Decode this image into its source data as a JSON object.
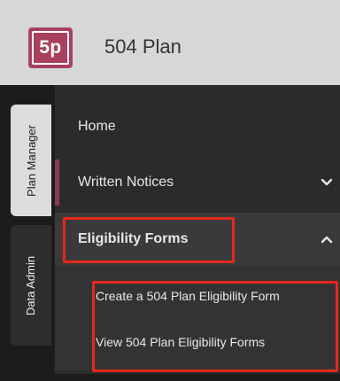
{
  "header": {
    "logo_text": "5p",
    "app_title": "504 Plan",
    "brand_color": "#a8405f"
  },
  "rail": {
    "tabs": [
      {
        "label": "Plan Manager",
        "active": true
      },
      {
        "label": "Data Admin",
        "active": false
      }
    ]
  },
  "menu": {
    "items": [
      {
        "label": "Home"
      },
      {
        "label": "Written Notices",
        "icon": "chevron-down-icon"
      },
      {
        "label": "Eligibility Forms",
        "icon": "chevron-up-icon",
        "expanded": true
      }
    ],
    "submenu": [
      {
        "label": "Create a 504 Plan Eligibility Form"
      },
      {
        "label": "View 504 Plan Eligibility Forms"
      }
    ]
  },
  "annotations": {
    "highlight_color": "#e8261b"
  }
}
